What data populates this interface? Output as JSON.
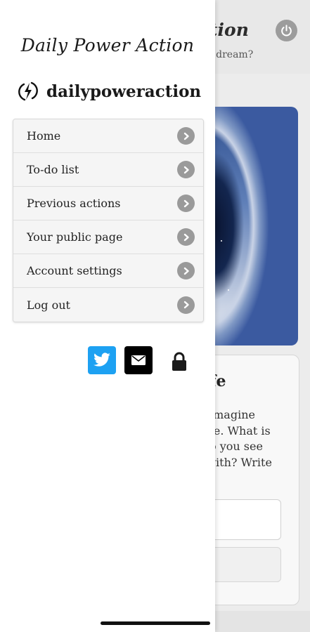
{
  "background": {
    "title": "tion",
    "subtitle": "r dream?",
    "card_title": "fe",
    "card_lines": [
      "imagine",
      "fe. What is",
      "o you see",
      "vith? Write"
    ],
    "power_icon": "power-icon"
  },
  "drawer": {
    "brand_script": "Daily Power Action",
    "logo_name": "dailypoweraction",
    "logo_icon": "lightning-bolt-icon",
    "menu": [
      {
        "label": "Home"
      },
      {
        "label": "To-do list"
      },
      {
        "label": "Previous actions"
      },
      {
        "label": "Your public page"
      },
      {
        "label": "Account settings"
      },
      {
        "label": "Log out"
      }
    ],
    "social": [
      "twitter-icon",
      "mail-icon",
      "lock-icon"
    ]
  },
  "colors": {
    "twitter": "#1da1f2",
    "mail_bg": "#000000",
    "chevron": "#9a9a9a",
    "menu_bg": "#f5f5f5"
  }
}
